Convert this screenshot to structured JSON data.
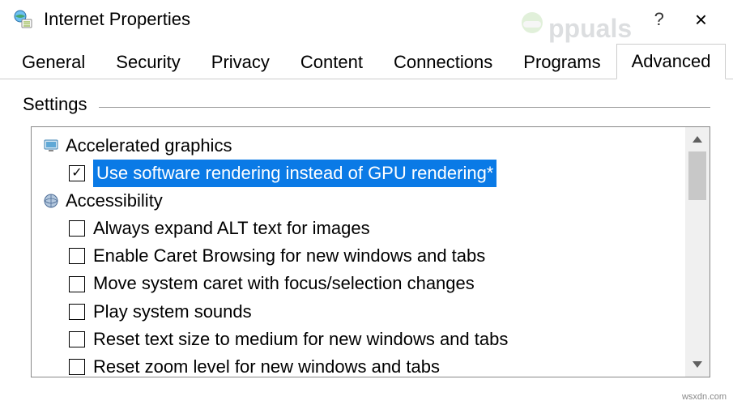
{
  "window": {
    "title": "Internet Properties",
    "help": "?",
    "close": "×"
  },
  "watermark": {
    "text": "Appuals"
  },
  "tabs": [
    {
      "label": "General"
    },
    {
      "label": "Security"
    },
    {
      "label": "Privacy"
    },
    {
      "label": "Content"
    },
    {
      "label": "Connections"
    },
    {
      "label": "Programs"
    },
    {
      "label": "Advanced",
      "active": true
    }
  ],
  "group": {
    "title": "Settings"
  },
  "tree": {
    "categories": [
      {
        "icon": "monitor-icon",
        "label": "Accelerated graphics",
        "options": [
          {
            "checked": true,
            "selected": true,
            "label": "Use software rendering instead of GPU rendering*"
          }
        ]
      },
      {
        "icon": "globe-icon",
        "label": "Accessibility",
        "options": [
          {
            "checked": false,
            "label": "Always expand ALT text for images"
          },
          {
            "checked": false,
            "label": "Enable Caret Browsing for new windows and tabs"
          },
          {
            "checked": false,
            "label": "Move system caret with focus/selection changes"
          },
          {
            "checked": false,
            "label": "Play system sounds"
          },
          {
            "checked": false,
            "label": "Reset text size to medium for new windows and tabs"
          },
          {
            "checked": false,
            "label": "Reset zoom level for new windows and tabs"
          }
        ]
      }
    ]
  },
  "attribution": "wsxdn.com"
}
